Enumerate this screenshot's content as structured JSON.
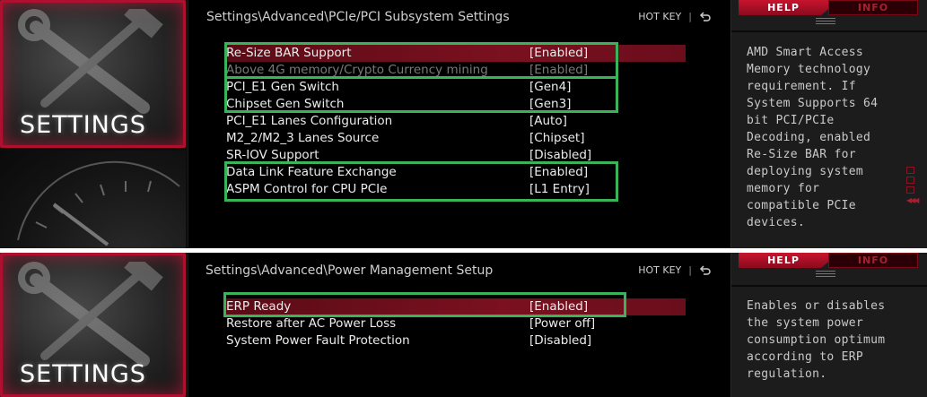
{
  "top": {
    "tile_label": "SETTINGS",
    "breadcrumb": "Settings\\Advanced\\PCIe/PCI Subsystem Settings",
    "hotkey": "HOT KEY",
    "hotkey_sep": "|",
    "rows": [
      {
        "label": "Re-Size BAR Support",
        "value": "[Enabled]"
      },
      {
        "label": "Above 4G memory/Crypto Currency mining",
        "value": "[Enabled]"
      },
      {
        "label": "PCI_E1 Gen Switch",
        "value": "[Gen4]"
      },
      {
        "label": "Chipset Gen Switch",
        "value": "[Gen3]"
      },
      {
        "label": "PCI_E1 Lanes Configuration",
        "value": "[Auto]"
      },
      {
        "label": "M2_2/M2_3 Lanes Source",
        "value": "[Chipset]"
      },
      {
        "label": "SR-IOV Support",
        "value": "[Disabled]"
      },
      {
        "label": "Data Link Feature Exchange",
        "value": "[Enabled]"
      },
      {
        "label": "ASPM Control for CPU PCIe",
        "value": "[L1 Entry]"
      }
    ],
    "help_tab": "HELP",
    "info_tab": "INFO",
    "help_text": "AMD Smart Access Memory technology requirement. If System Supports 64 bit PCI/PCIe Decoding, enabled Re-Size BAR for deploying system memory for compatible PCIe devices."
  },
  "bottom": {
    "tile_label": "SETTINGS",
    "breadcrumb": "Settings\\Advanced\\Power Management Setup",
    "hotkey": "HOT KEY",
    "hotkey_sep": "|",
    "rows": [
      {
        "label": "ERP Ready",
        "value": "[Enabled]"
      },
      {
        "label": "Restore after AC Power Loss",
        "value": "[Power off]"
      },
      {
        "label": "System Power Fault Protection",
        "value": "[Disabled]"
      }
    ],
    "help_tab": "HELP",
    "info_tab": "INFO",
    "help_text": "Enables or disables the system power consumption optimum according to ERP regulation."
  },
  "colors": {
    "accent_red": "#c8142e",
    "highlight_green": "#3bb35a",
    "selected_row": "#7a1020"
  },
  "icons": [
    "wrench-hammer-icon",
    "back-arrow-icon",
    "scroll-arrows-icon"
  ]
}
